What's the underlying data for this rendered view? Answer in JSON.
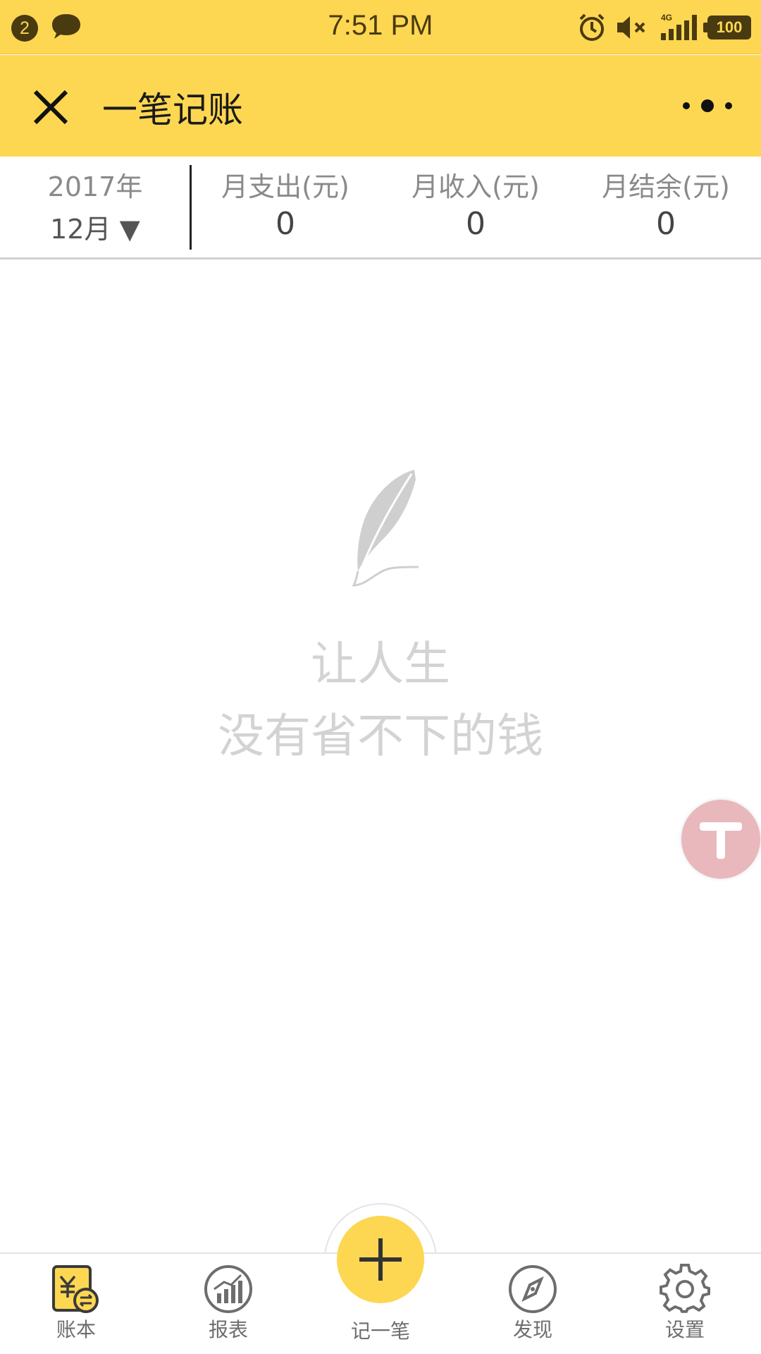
{
  "status_bar": {
    "notification_count": "2",
    "time": "7:51 PM",
    "network": "4G",
    "battery": "100",
    "icons": [
      "chat-bubble-icon",
      "alarm-icon",
      "mute-icon",
      "signal-icon",
      "battery-icon"
    ]
  },
  "header": {
    "title": "一笔记账",
    "close_icon": "close-icon",
    "more_icon": "more-icon"
  },
  "summary": {
    "year": "2017年",
    "month": "12月 ▼",
    "stats": [
      {
        "label": "月支出(元)",
        "value": "0"
      },
      {
        "label": "月收入(元)",
        "value": "0"
      },
      {
        "label": "月结余(元)",
        "value": "0"
      }
    ]
  },
  "empty_state": {
    "icon": "feather-icon",
    "line1": "让人生",
    "line2": "没有省不下的钱"
  },
  "float_button": {
    "icon": "tool-icon"
  },
  "tabbar": {
    "tabs": [
      {
        "label": "账本",
        "icon": "ledger-icon",
        "active": true
      },
      {
        "label": "报表",
        "icon": "chart-icon",
        "active": false
      },
      {
        "label": "发现",
        "icon": "compass-icon",
        "active": false
      },
      {
        "label": "设置",
        "icon": "gear-icon",
        "active": false
      }
    ],
    "center": {
      "label": "记一笔",
      "icon": "plus-icon"
    }
  },
  "colors": {
    "brand_yellow": "#fdd752",
    "float_button": "#e8b8bd",
    "muted_text": "#d3d3d3"
  }
}
